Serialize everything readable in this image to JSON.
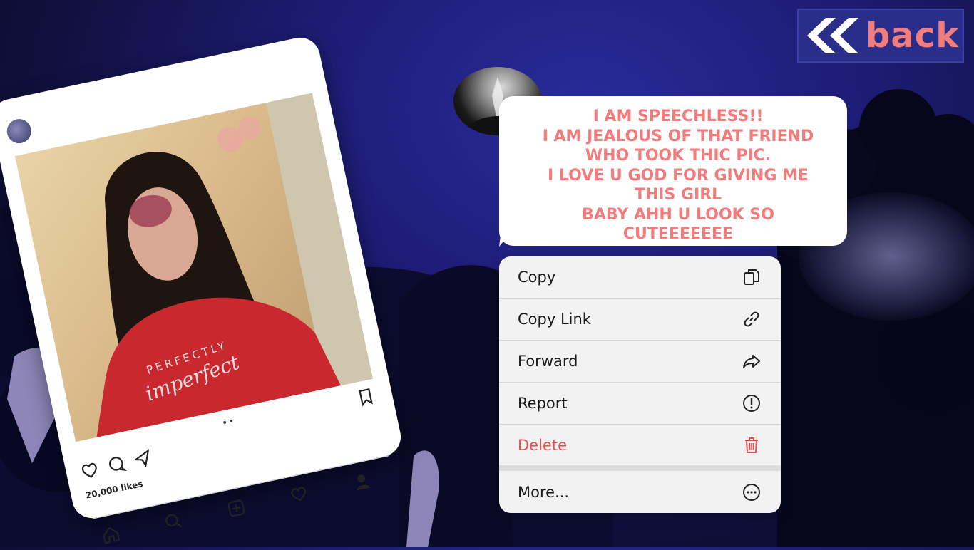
{
  "back_button": {
    "label": "back",
    "accent": "#f27d7d"
  },
  "post": {
    "sweater_line1": "PERFECTLY",
    "sweater_line2": "imperfect",
    "likes": "20,000 likes"
  },
  "comment": {
    "lines": [
      "I am speechless!!",
      "I am jealous of that friend",
      "who took thic pic.",
      "I love u god for giving me",
      "this girl",
      "baby ahh u look so",
      "cuteeeeeee"
    ],
    "color": "#f27b7b"
  },
  "context_menu": {
    "items": [
      {
        "label": "Copy",
        "icon": "copy-icon"
      },
      {
        "label": "Copy Link",
        "icon": "link-icon"
      },
      {
        "label": "Forward",
        "icon": "forward-icon"
      },
      {
        "label": "Report",
        "icon": "report-icon"
      },
      {
        "label": "Delete",
        "icon": "trash-icon",
        "color": "#ea4d4d"
      },
      {
        "label": "More...",
        "icon": "more-icon"
      }
    ]
  }
}
